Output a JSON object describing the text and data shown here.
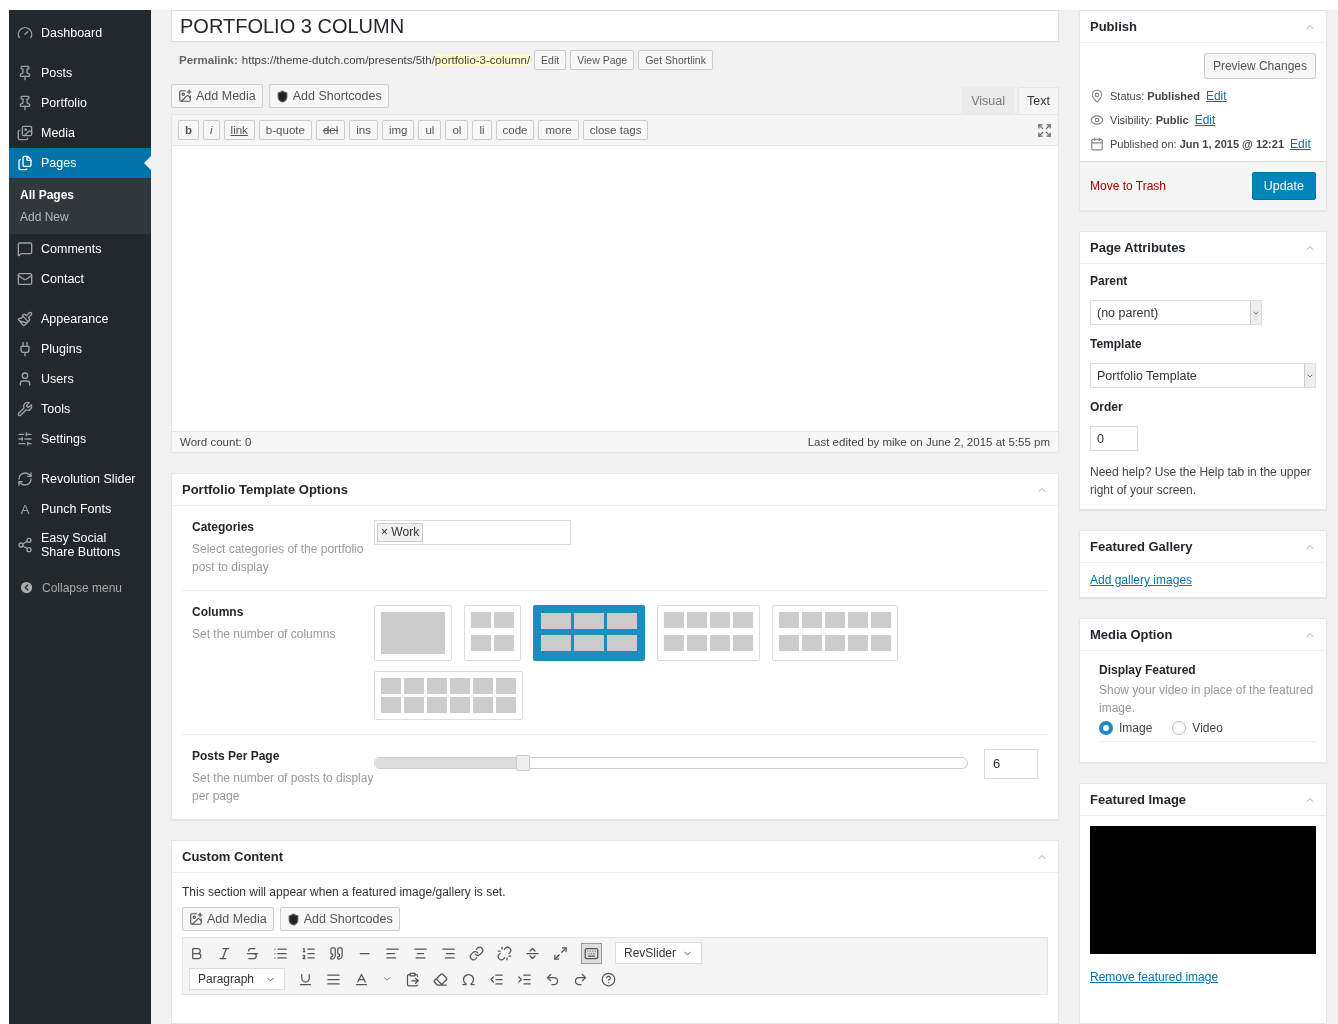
{
  "sidebar": {
    "groups": [
      [
        {
          "label": "Dashboard",
          "selected": false
        }
      ],
      [
        {
          "label": "Posts",
          "selected": false
        },
        {
          "label": "Portfolio",
          "selected": false
        },
        {
          "label": "Media",
          "selected": false
        },
        {
          "label": "Pages",
          "selected": true,
          "children": [
            {
              "label": "All Pages",
              "selected": true
            },
            {
              "label": "Add New",
              "selected": false
            }
          ]
        },
        {
          "label": "Comments",
          "selected": false
        },
        {
          "label": "Contact",
          "selected": false
        }
      ],
      [
        {
          "label": "Appearance",
          "selected": false
        },
        {
          "label": "Plugins",
          "selected": false
        },
        {
          "label": "Users",
          "selected": false
        },
        {
          "label": "Tools",
          "selected": false
        },
        {
          "label": "Settings",
          "selected": false
        }
      ],
      [
        {
          "label": "Revolution Slider",
          "selected": false
        },
        {
          "label": "Punch Fonts",
          "selected": false,
          "glyph": "A"
        },
        {
          "label": "Easy Social Share Buttons",
          "selected": false
        }
      ]
    ],
    "collapse": "Collapse menu"
  },
  "editor": {
    "title": "PORTFOLIO 3 COLUMN",
    "permalink": {
      "label": "Permalink:",
      "base": "https://theme-dutch.com/presents/5th/",
      "slug": "portfolio-3-column/",
      "buttons": [
        "Edit",
        "View Page",
        "Get Shortlink"
      ]
    },
    "media_buttons": [
      "Add Media",
      "Add Shortcodes"
    ],
    "tabs": [
      {
        "label": "Visual",
        "selected": false
      },
      {
        "label": "Text",
        "selected": true
      }
    ],
    "quicktags": [
      {
        "label": "b",
        "kind": "bold"
      },
      {
        "label": "i",
        "kind": "italic"
      },
      {
        "label": "link",
        "kind": "underline"
      },
      {
        "label": "b-quote"
      },
      {
        "label": "del",
        "kind": "strike"
      },
      {
        "label": "ins"
      },
      {
        "label": "img"
      },
      {
        "label": "ul"
      },
      {
        "label": "ol"
      },
      {
        "label": "li"
      },
      {
        "label": "code"
      },
      {
        "label": "more"
      },
      {
        "label": "close tags"
      }
    ],
    "word_count": "Word count: 0",
    "last_edited": "Last edited by mike on June 2, 2015 at 5:55 pm"
  },
  "portfolio_options": {
    "title": "Portfolio Template Options",
    "categories": {
      "label": "Categories",
      "description": "Select categories of the portfolio post to display",
      "remove": "×",
      "tag": "Work"
    },
    "columns": {
      "label": "Columns",
      "description": "Set the number of columns",
      "options": [
        {
          "selected": false
        },
        {
          "selected": false
        },
        {
          "selected": true
        },
        {
          "selected": false
        },
        {
          "selected": false
        },
        {
          "selected": false
        }
      ]
    },
    "posts_per_page": {
      "label": "Posts Per Page",
      "description": "Set the number of posts to display per page",
      "level": 0.25,
      "value": "6"
    }
  },
  "custom_content": {
    "title": "Custom Content",
    "note": "This section will appear when a featured image/gallery is set.",
    "media_buttons": [
      "Add Media",
      "Add Shortcodes"
    ],
    "shortcode_menu": "RevSlider",
    "format": "Paragraph"
  },
  "publish": {
    "title": "Publish",
    "preview": "Preview Changes",
    "rows": [
      {
        "label": "Status:",
        "value": "Published",
        "link": "Edit"
      },
      {
        "label": "Visibility:",
        "value": "Public",
        "link": "Edit"
      },
      {
        "label": "Published on:",
        "value": "Jun 1, 2015 @ 12:21",
        "link": "Edit"
      }
    ],
    "trash": "Move to Trash",
    "update": "Update"
  },
  "page_attributes": {
    "title": "Page Attributes",
    "parent_label": "Parent",
    "parent": "(no parent)",
    "template_label": "Template",
    "template": "Portfolio Template",
    "order_label": "Order",
    "order": "0",
    "help": "Need help? Use the Help tab in the upper right of your screen."
  },
  "featured_gallery": {
    "title": "Featured Gallery",
    "link": "Add gallery images"
  },
  "media_option": {
    "title": "Media Option",
    "label": "Display Featured",
    "description": "Show your video in place of the featured image.",
    "choices": [
      {
        "label": "Image",
        "selected": true
      },
      {
        "label": "Video",
        "selected": false
      }
    ]
  },
  "featured_image": {
    "title": "Featured Image",
    "link": "Remove featured image"
  }
}
